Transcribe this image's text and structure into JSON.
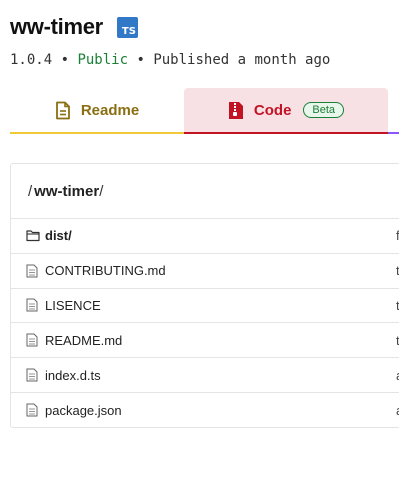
{
  "package": {
    "name": "ww-timer",
    "ts_badge": "TS"
  },
  "meta": {
    "version": "1.0.4",
    "sep1": " • ",
    "visibility": "Public",
    "sep2": " • ",
    "published": "Published a month ago"
  },
  "tabs": {
    "readme": "Readme",
    "code": "Code",
    "beta": "Beta"
  },
  "breadcrumb": {
    "sep_left": "/",
    "path": "ww-timer",
    "sep_right": "/"
  },
  "files": [
    {
      "name": "dist/",
      "type": "folder",
      "trailing": "f"
    },
    {
      "name": "CONTRIBUTING.md",
      "type": "file",
      "trailing": "t"
    },
    {
      "name": "LISENCE",
      "type": "file",
      "trailing": "t"
    },
    {
      "name": "README.md",
      "type": "file",
      "trailing": "t"
    },
    {
      "name": "index.d.ts",
      "type": "file",
      "trailing": "a"
    },
    {
      "name": "package.json",
      "type": "file",
      "trailing": "a"
    }
  ],
  "colors": {
    "ts_blue": "#3178c6",
    "public_green": "#1a7f37",
    "readme_accent": "#f0c93a",
    "code_accent": "#c21325",
    "code_bg": "#f7e1e4",
    "tabs_line_purple": "#8956ff"
  }
}
